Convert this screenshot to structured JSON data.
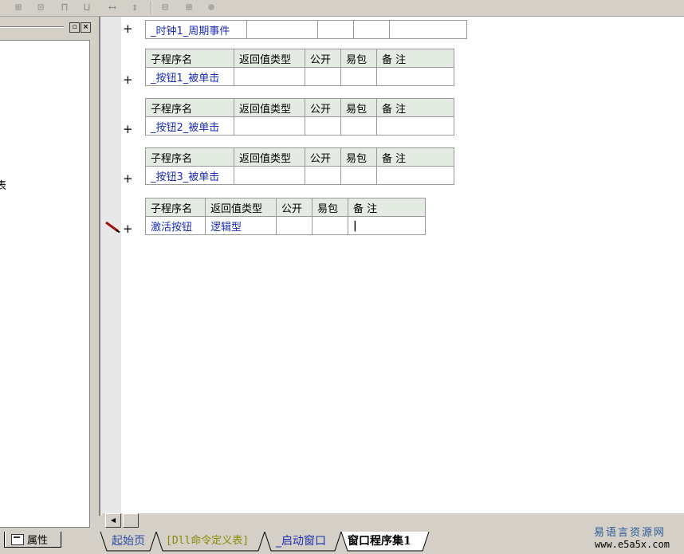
{
  "toolbar": {
    "icons": [
      "align-left-icon",
      "align-center-icon",
      "align-top-icon",
      "align-bottom-icon",
      "same-width-icon",
      "same-height-icon",
      "h-spacing-icon",
      "v-spacing-icon",
      "center-icon"
    ]
  },
  "left_panel": {
    "cut_text": "表",
    "pin_glyph": "▫",
    "close_glyph": "×",
    "property_tab_label": "属性"
  },
  "editor": {
    "event_row": {
      "plus": "+",
      "name": "_时钟1_周期事件"
    },
    "headers": [
      "子程序名",
      "返回值类型",
      "公开",
      "易包",
      "备 注"
    ],
    "subroutines": [
      {
        "plus": "+",
        "name": "_按钮1_被单击",
        "return_type": ""
      },
      {
        "plus": "+",
        "name": "_按钮2_被单击",
        "return_type": ""
      },
      {
        "plus": "+",
        "name": "_按钮3_被单击",
        "return_type": ""
      },
      {
        "plus": "+",
        "name": "激活按钮",
        "return_type": "逻辑型"
      }
    ],
    "cursor": "|"
  },
  "scrollbar": {
    "left_arrow": "◀"
  },
  "tabs": [
    {
      "label": "起始页",
      "color": "#2a4aa8"
    },
    {
      "label": "[Dll命令定义表]",
      "color": "#8a8a00"
    },
    {
      "label": "_启动窗口",
      "color": "#1a2db0"
    },
    {
      "label": "窗口程序集1",
      "color": "#000000",
      "active": true
    }
  ],
  "watermark": {
    "line1": "易语言资源网",
    "line2": "www.e5a5x.com"
  }
}
